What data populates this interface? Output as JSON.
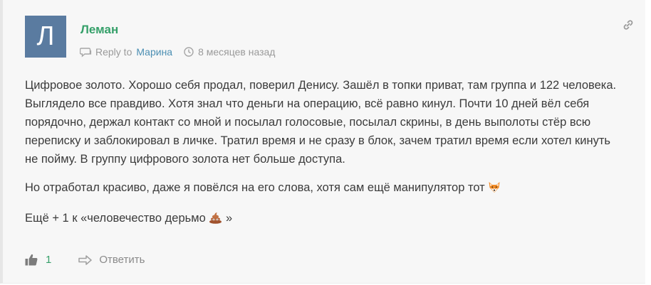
{
  "comment": {
    "avatar_letter": "Л",
    "author": "Леман",
    "reply_prefix": "Reply to",
    "reply_to": "Марина",
    "time_ago": "8 месяцев назад",
    "paragraphs": [
      "Цифровое золото. Хорошо себя продал, поверил Денису. Зашёл в топки приват, там группа и 122 человека. Выглядело все правдиво. Хотя знал что деньги на операцию, всё равно кинул. Почти 10 дней вёл себя порядочно, держал контакт со мной и посылал голосовые, посылал скрины, в день выполоты стёр всю переписку и заблокировал в личке. Тратил время и не сразу в блок, зачем тратил время если хотел кинуть не пойму. В группу цифрового золота нет больше доступа.",
      "Но отработал красиво, даже я повёлся на его слова, хотя сам ещё манипулятор тот",
      "Ещё + 1 к «человечество дерьмо",
      "»"
    ],
    "emoji_1": "fox-face-icon",
    "emoji_2": "poop-icon",
    "likes": "1",
    "reply_label": "Ответить"
  },
  "colors": {
    "author": "#36a06a",
    "link": "#4c8fb3",
    "avatar_bg": "#5a7ba0",
    "meta": "#9a9a9a",
    "body_text": "#3b3b3b",
    "panel_bg": "#f7f7f7"
  }
}
